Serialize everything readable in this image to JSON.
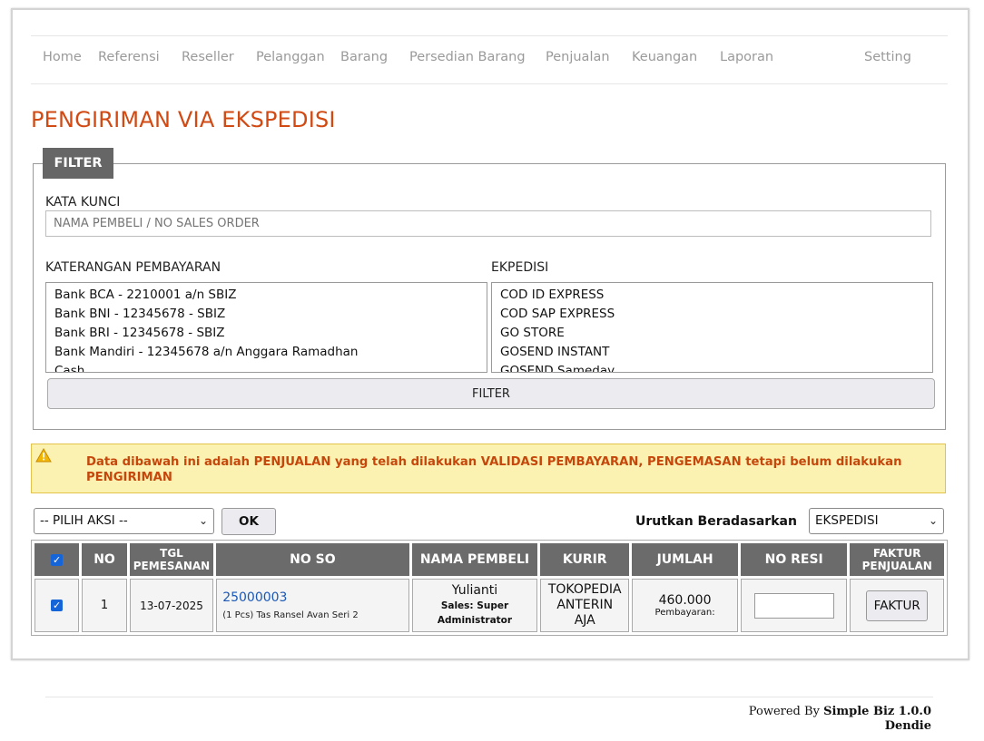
{
  "nav": {
    "items": [
      "Home",
      "Referensi",
      "Reseller",
      "Pelanggan",
      "Barang",
      "Persedian Barang",
      "Penjualan",
      "Keuangan",
      "Laporan"
    ],
    "setting": "Setting"
  },
  "page_title": "PENGIRIMAN VIA EKSPEDISI",
  "filter": {
    "legend": "FILTER",
    "keyword_label": "KATA KUNCI",
    "keyword_placeholder": "NAMA PEMBELI / NO SALES ORDER",
    "keyword_value": "",
    "payment_label": "KATERANGAN PEMBAYARAN",
    "payment_options": [
      "Bank BCA - 2210001 a/n SBIZ",
      "Bank BNI - 12345678 - SBIZ",
      "Bank BRI - 12345678 - SBIZ",
      "Bank Mandiri - 12345678 a/n Anggara Ramadhan",
      "Cash"
    ],
    "expedition_label": "EKPEDISI",
    "expedition_options": [
      "COD ID EXPRESS",
      "COD SAP EXPRESS",
      "GO STORE",
      "GOSEND INSTANT",
      "GOSEND Sameday"
    ],
    "button_label": "FILTER"
  },
  "alert": {
    "icon": "warning-icon",
    "message": "Data dibawah ini adalah PENJUALAN yang telah dilakukan VALIDASI PEMBAYARAN, PENGEMASAN tetapi belum dilakukan PENGIRIMAN"
  },
  "actions": {
    "action_select": "-- PILIH AKSI --",
    "ok_label": "OK",
    "sort_label": "Urutkan Beradasarkan",
    "sort_select": "EKSPEDISI"
  },
  "table": {
    "headers": {
      "no": "NO",
      "tgl_1": "TGL",
      "tgl_2": "PEMESANAN",
      "no_so": "NO SO",
      "nama": "NAMA PEMBELI",
      "kurir": "KURIR",
      "jumlah": "JUMLAH",
      "no_resi": "NO RESI",
      "faktur_1": "FAKTUR",
      "faktur_2": "PENJUALAN"
    },
    "rows": [
      {
        "checked": true,
        "no": "1",
        "tgl": "13-07-2025",
        "no_so": "25000003",
        "item": "(1 Pcs) Tas Ransel Avan Seri 2",
        "nama": "Yulianti",
        "sales": "Sales: Super Administrator",
        "kurir": "TOKOPEDIA ANTERIN AJA",
        "jumlah": "460.000",
        "pembayaran": "Pembayaran:",
        "no_resi": "",
        "faktur_label": "FAKTUR"
      }
    ]
  },
  "footer": {
    "powered_prefix": "Powered By",
    "product": "Simple Biz 1.0.0",
    "author": "Dendie"
  },
  "colors": {
    "title": "#d24a13",
    "header_bg": "#6b6b6b",
    "alert_bg": "#fbf1b0",
    "alert_text": "#c6470c",
    "link": "#1a58b8",
    "checkbox": "#1565d8"
  }
}
